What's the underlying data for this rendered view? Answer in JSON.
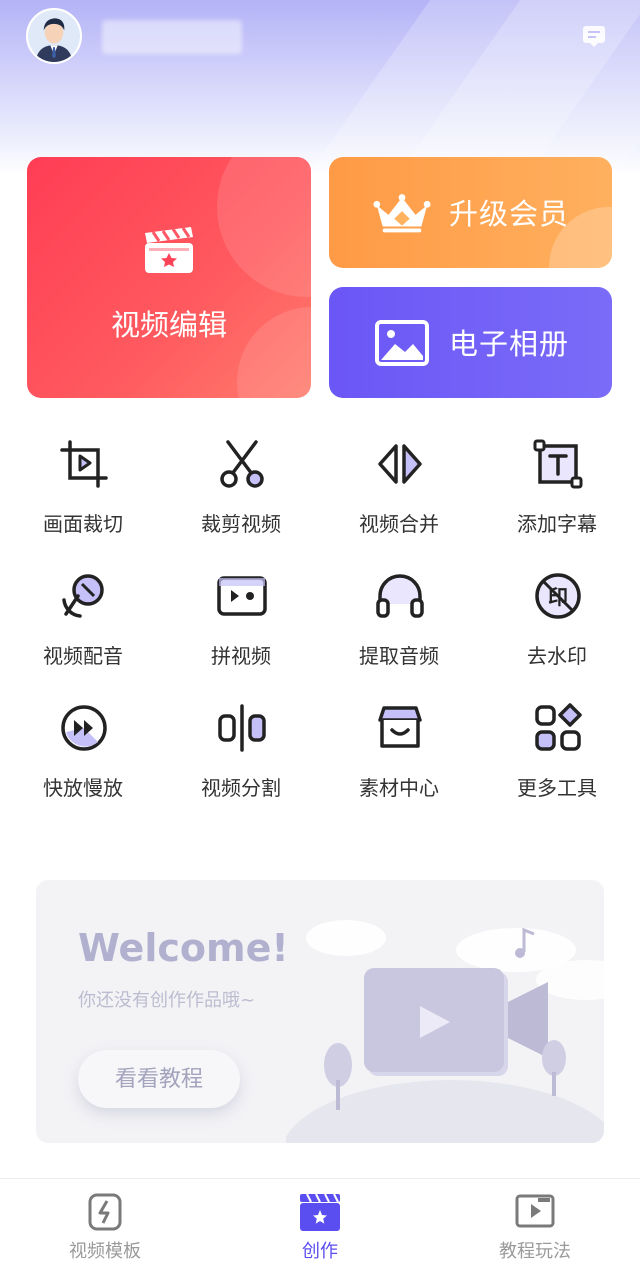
{
  "header": {
    "avatar_icon": "user-avatar-icon",
    "message_icon": "message-icon"
  },
  "cards": {
    "edit_label": "视频编辑",
    "vip_label": "升级会员",
    "album_label": "电子相册"
  },
  "tools": [
    {
      "label": "画面裁切",
      "icon": "crop-icon"
    },
    {
      "label": "裁剪视频",
      "icon": "scissors-icon"
    },
    {
      "label": "视频合并",
      "icon": "merge-icon"
    },
    {
      "label": "添加字幕",
      "icon": "text-icon"
    },
    {
      "label": "视频配音",
      "icon": "microphone-icon"
    },
    {
      "label": "拼视频",
      "icon": "splice-icon"
    },
    {
      "label": "提取音频",
      "icon": "headphones-icon"
    },
    {
      "label": "去水印",
      "icon": "watermark-icon"
    },
    {
      "label": "快放慢放",
      "icon": "fast-forward-icon"
    },
    {
      "label": "视频分割",
      "icon": "split-icon"
    },
    {
      "label": "素材中心",
      "icon": "store-icon"
    },
    {
      "label": "更多工具",
      "icon": "more-tools-icon"
    }
  ],
  "welcome": {
    "title": "Welcome!",
    "subtitle": "你还没有创作作品哦~",
    "button": "看看教程"
  },
  "tabbar": [
    {
      "label": "视频模板",
      "icon": "template-icon",
      "active": false
    },
    {
      "label": "创作",
      "icon": "clapperboard-icon",
      "active": true
    },
    {
      "label": "教程玩法",
      "icon": "tutorial-icon",
      "active": false
    }
  ],
  "colors": {
    "accent": "#5b4ef0",
    "edit_card": "#ff4257",
    "vip_card": "#ffa552",
    "album_card": "#6f5ef7"
  }
}
